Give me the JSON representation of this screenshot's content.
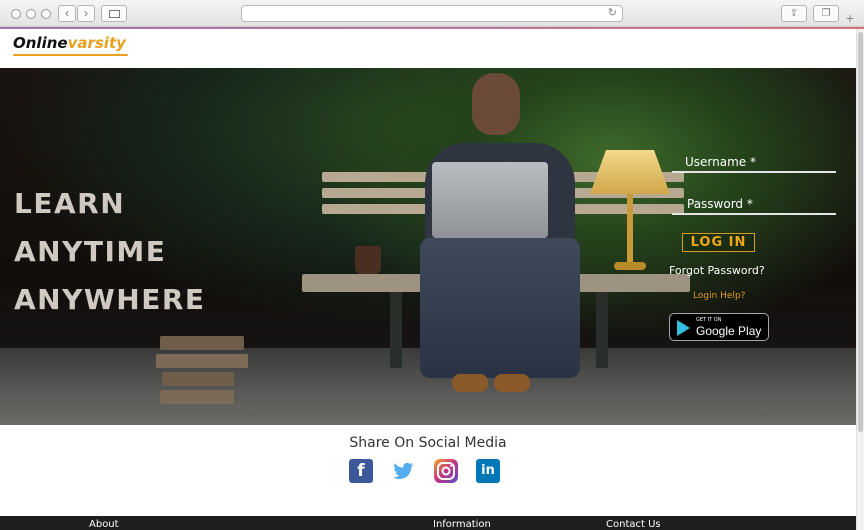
{
  "site": {
    "logo": {
      "part1": "Online",
      "part2": "varsity"
    }
  },
  "hero": {
    "tagline": [
      "LEARN",
      "ANYTIME",
      "ANYWHERE"
    ]
  },
  "login": {
    "username_label": "Username *",
    "password_label": "Password *",
    "login_button": "LOG IN",
    "forgot_password": "Forgot Password?",
    "login_help": "Login Help?",
    "google_play": {
      "small": "GET IT ON",
      "big": "Google Play"
    }
  },
  "social": {
    "title": "Share On Social Media",
    "icons": [
      "facebook-icon",
      "twitter-icon",
      "instagram-icon",
      "linkedin-icon"
    ],
    "facebook_glyph": "f",
    "linkedin_glyph": "in"
  },
  "footer": {
    "items": [
      "About",
      "Information",
      "Contact Us"
    ]
  },
  "colors": {
    "accent": "#e8a020",
    "facebook": "#3b5998",
    "twitter": "#55acee",
    "instagram": "#c13584",
    "linkedin": "#0077b5",
    "footer": "#1e1e1e"
  }
}
